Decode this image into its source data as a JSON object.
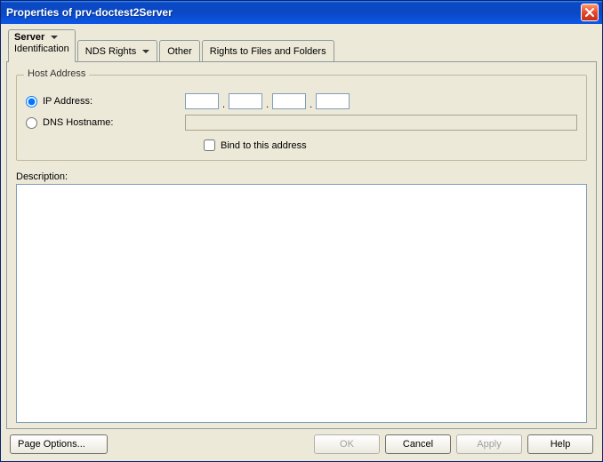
{
  "window": {
    "title": "Properties of prv-doctest2Server"
  },
  "tabs": {
    "server": {
      "label": "Server",
      "sub": "Identification"
    },
    "nds": {
      "label": "NDS Rights"
    },
    "other": {
      "label": "Other"
    },
    "rff": {
      "label": "Rights to Files and Folders"
    }
  },
  "hostAddress": {
    "legend": "Host Address",
    "ipRadio": "IP Address:",
    "dnsRadio": "DNS Hostname:",
    "ip": {
      "a": "",
      "b": "",
      "c": "",
      "d": ""
    },
    "dnsValue": "",
    "bindLabel": "Bind to this address"
  },
  "descriptionLabel": "Description:",
  "descriptionValue": "",
  "buttons": {
    "pageOptions": "Page Options...",
    "ok": "OK",
    "cancel": "Cancel",
    "apply": "Apply",
    "help": "Help"
  }
}
